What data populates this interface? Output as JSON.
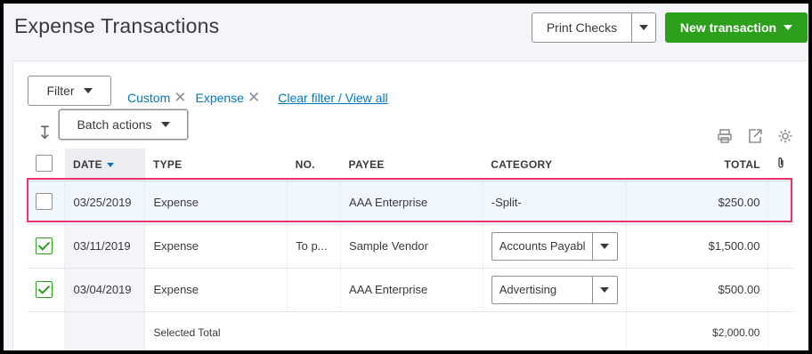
{
  "page": {
    "title": "Expense Transactions"
  },
  "header": {
    "print_checks_label": "Print Checks",
    "new_transaction_label": "New transaction"
  },
  "filters": {
    "filter_label": "Filter",
    "chips": [
      "Custom",
      "Expense"
    ],
    "clear_link": "Clear filter / View all"
  },
  "toolbar": {
    "batch_actions_label": "Batch actions",
    "icons": [
      "print-icon",
      "export-icon",
      "settings-icon"
    ]
  },
  "table": {
    "columns": [
      "DATE",
      "TYPE",
      "NO.",
      "PAYEE",
      "CATEGORY",
      "TOTAL"
    ],
    "rows": [
      {
        "checked": false,
        "date": "03/25/2019",
        "type": "Expense",
        "no": "",
        "payee": "AAA Enterprise",
        "category": "-Split-",
        "category_is_select": false,
        "total": "$250.00"
      },
      {
        "checked": true,
        "date": "03/11/2019",
        "type": "Expense",
        "no": "To p...",
        "payee": "Sample Vendor",
        "category": "Accounts Payabl",
        "category_is_select": true,
        "total": "$1,500.00"
      },
      {
        "checked": true,
        "date": "03/04/2019",
        "type": "Expense",
        "no": "",
        "payee": "AAA Enterprise",
        "category": "Advertising",
        "category_is_select": true,
        "total": "$500.00"
      }
    ],
    "selected_total_label": "Selected Total",
    "selected_total_value": "$2,000.00"
  },
  "colors": {
    "primary_green": "#2ca01c",
    "link_blue": "#0077c5",
    "highlight_pink": "#e8336d"
  }
}
